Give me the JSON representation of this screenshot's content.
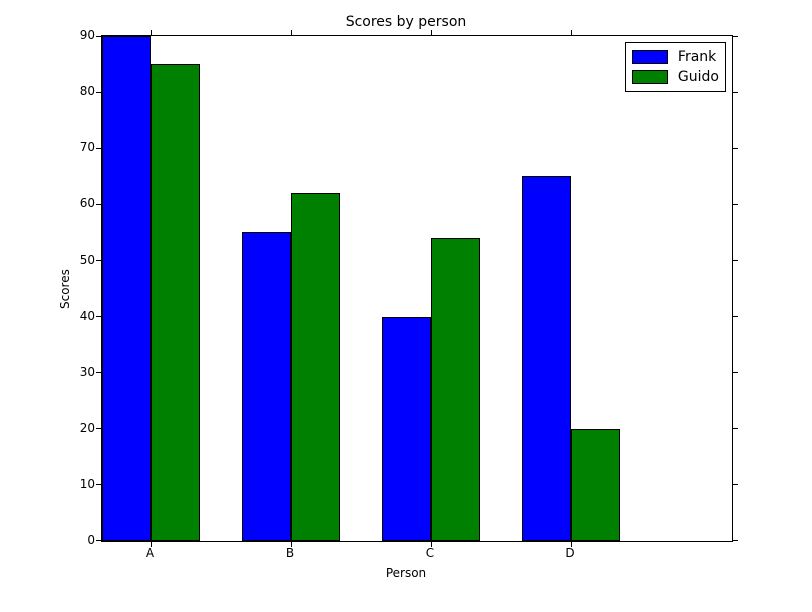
{
  "chart_data": {
    "type": "bar",
    "title": "Scores by person",
    "xlabel": "Person",
    "ylabel": "Scores",
    "categories": [
      "A",
      "B",
      "C",
      "D"
    ],
    "series": [
      {
        "name": "Frank",
        "values": [
          90,
          55,
          40,
          65
        ],
        "color": "#0000ff"
      },
      {
        "name": "Guido",
        "values": [
          85,
          62,
          54,
          20
        ],
        "color": "#008000"
      }
    ],
    "ylim": [
      0,
      90
    ],
    "yticks": [
      0,
      10,
      20,
      30,
      40,
      50,
      60,
      70,
      80,
      90
    ],
    "xlim": [
      0,
      4.5
    ],
    "legend_position": "upper right"
  }
}
